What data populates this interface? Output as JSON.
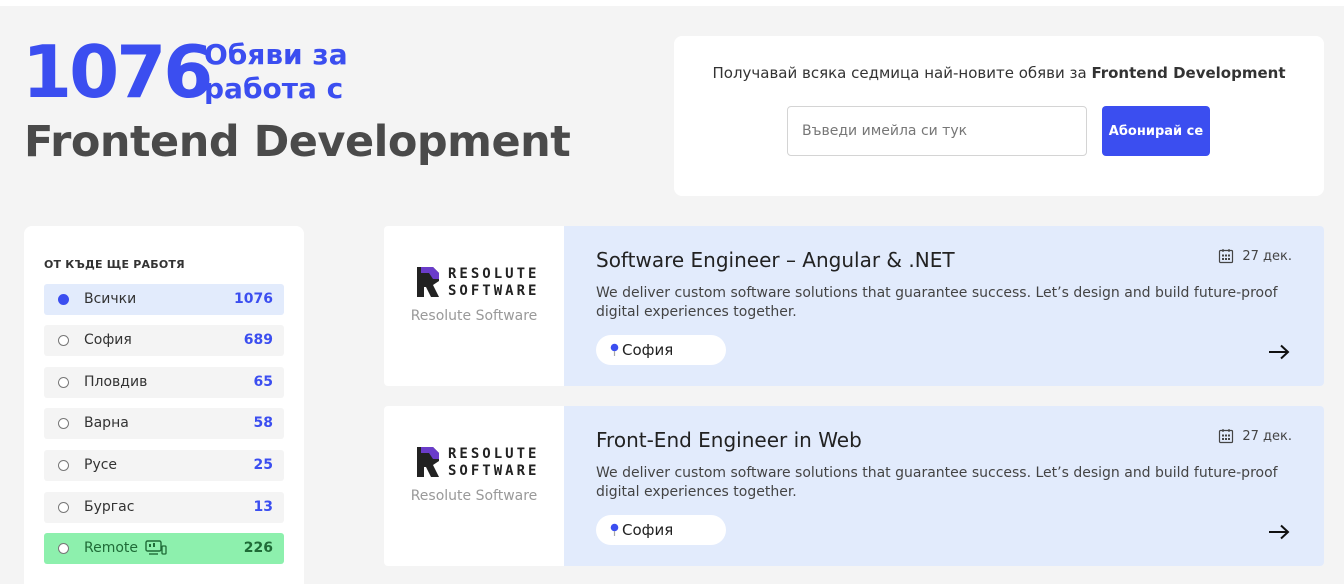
{
  "header": {
    "count": "1076",
    "count_sub": "Обяви за работа с",
    "topic": "Frontend Development"
  },
  "subscribe": {
    "text_prefix": "Получавай всяка седмица най-новите обяви за ",
    "text_topic": "Frontend Development",
    "placeholder": "Въведи имейла си тук",
    "button": "Абонирай се"
  },
  "filter": {
    "title": "ОТ КЪДЕ ЩЕ РАБОТЯ",
    "items": [
      {
        "label": "Всички",
        "count": "1076",
        "selected": true
      },
      {
        "label": "София",
        "count": "689"
      },
      {
        "label": "Пловдив",
        "count": "65"
      },
      {
        "label": "Варна",
        "count": "58"
      },
      {
        "label": "Русе",
        "count": "25"
      },
      {
        "label": "Бургас",
        "count": "13"
      },
      {
        "label": "Remote",
        "count": "226",
        "icon": "remote-work-icon"
      }
    ]
  },
  "jobs": [
    {
      "company_logo_word": [
        "RESOLUTE",
        "SOFTWARE"
      ],
      "company_caption": "Resolute Software",
      "title": "Software Engineer – Angular & .NET",
      "date": "27 дек.",
      "description": "We deliver custom software solutions that guarantee success. Let’s design and build future-proof digital experiences together.",
      "location": "София"
    },
    {
      "company_logo_word": [
        "RESOLUTE",
        "SOFTWARE"
      ],
      "company_caption": "Resolute Software",
      "title": "Front-End Engineer in Web",
      "date": "27 дек.",
      "description": "We deliver custom software solutions that guarantee success. Let’s design and build future-proof digital experiences together.",
      "location": "София"
    }
  ],
  "colors": {
    "accent": "#3b4ef0",
    "remote_bg": "#8df0ad",
    "job_bg": "#e2ebfc",
    "logo_purple": "#6a3cc9"
  }
}
